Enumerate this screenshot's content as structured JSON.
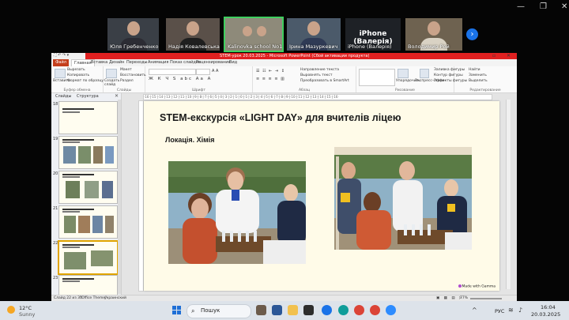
{
  "meeting": {
    "participants": [
      {
        "name": "Юля Гребенченко"
      },
      {
        "name": "Надія Ковалевська"
      },
      {
        "name": "Kalinovka school No1"
      },
      {
        "name": "Ірина Мазуркевич"
      },
      {
        "name": "iPhone (Валерія)",
        "big": "iPhone (Валерія)"
      },
      {
        "name": "Володимир Рой"
      }
    ],
    "next_icon": "chevron-right-icon"
  },
  "window_controls": {
    "minimize": "—",
    "restore": "❐",
    "close": "✕"
  },
  "powerpoint": {
    "qat": "⛶ ↶ ↷ ▾",
    "title_strip": "STEM-урок 20.03.2025 - Microsoft PowerPoint (Сбой активации продукта)",
    "tabs": [
      "Файл",
      "Главная",
      "Вставка",
      "Дизайн",
      "Переходы",
      "Анимация",
      "Показ слайдов",
      "Рецензирование",
      "Вид"
    ],
    "active_tab": "Главная",
    "ribbon": {
      "groups": [
        "Буфер обмена",
        "Слайды",
        "Шрифт",
        "Абзац",
        "Рисование",
        "Редактирование"
      ],
      "paste": "Вставить",
      "cut": "Вырезать",
      "copy": "Копировать",
      "format_painter": "Формат по образцу",
      "new_slide": "Создать слайд",
      "layout": "Макет",
      "reset": "Восстановить",
      "section": "Раздел",
      "text_direction": "Направление текста",
      "align_text": "Выровнять текст",
      "smartart": "Преобразовать в SmartArt",
      "arrange": "Упорядочить",
      "quick_styles": "Экспресс-стили",
      "shape_fill": "Заливка фигуры",
      "shape_outline": "Контур фигуры",
      "shape_effects": "Эффекты фигуры",
      "find": "Найти",
      "replace": "Заменить",
      "select": "Выделить"
    },
    "panel": {
      "tab_slides": "Слайды",
      "tab_outline": "Структура",
      "close": "✕",
      "slide_numbers": [
        "18",
        "19",
        "20",
        "21",
        "22",
        "23"
      ]
    },
    "ruler_text": "·16·|·15·|·14·|·13·|·12·|·11·|·10·|·9·|·8·|·7·|·6·|·5·|·4·|·3·|·2·|·1·|·0·|·1·|·2·|·3·|·4·|·5·|·6·|·7·|·8·|·9·|·10·|·11·|·12·|·13·|·14·|·15·|·16·",
    "slide": {
      "title": "STEM-екскурсія «LIGHT DAY» для вчителів ліцею",
      "subtitle": "Локація. Хімія",
      "badge": "Made with Gamma"
    },
    "status": {
      "slide_counter": "Слайд 22 из 30",
      "theme": "\"Office Theme\"",
      "language": "украинский",
      "zoom": "77%"
    }
  },
  "taskbar": {
    "temperature": "12°C",
    "weather": "Sunny",
    "search_placeholder": "Пошук",
    "language": "РУС",
    "time": "16:04",
    "date": "20.03.2025"
  }
}
